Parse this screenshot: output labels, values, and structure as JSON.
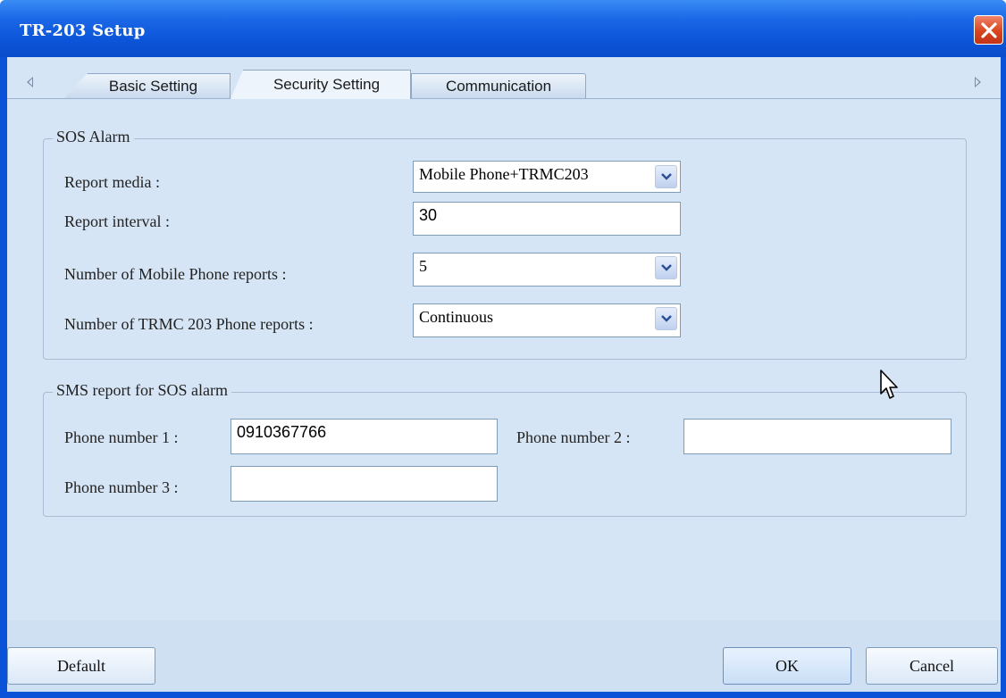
{
  "window": {
    "title": "TR-203 Setup"
  },
  "tabs": [
    {
      "label": "Basic Setting",
      "active": false
    },
    {
      "label": "Security Setting",
      "active": true
    },
    {
      "label": "Communication",
      "active": false
    }
  ],
  "sos_alarm": {
    "legend": "SOS Alarm",
    "report_media": {
      "label": "Report media :",
      "value": "Mobile Phone+TRMC203"
    },
    "report_interval": {
      "label": "Report interval :",
      "value": "30"
    },
    "mobile_reports": {
      "label": "Number of Mobile Phone reports :",
      "value": "5"
    },
    "trmc_reports": {
      "label": "Number of  TRMC 203 Phone reports :",
      "value": "Continuous"
    }
  },
  "sms_report": {
    "legend": "SMS report for SOS alarm",
    "phone1": {
      "label": "Phone number 1 :",
      "value": "0910367766"
    },
    "phone2": {
      "label": "Phone number 2 :",
      "value": ""
    },
    "phone3": {
      "label": "Phone number 3 :",
      "value": ""
    }
  },
  "buttons": {
    "default": "Default",
    "ok": "OK",
    "cancel": "Cancel"
  },
  "colors": {
    "title_bar": "#0c55d9",
    "close_button": "#d8451f",
    "panel": "#d6e5f5"
  }
}
